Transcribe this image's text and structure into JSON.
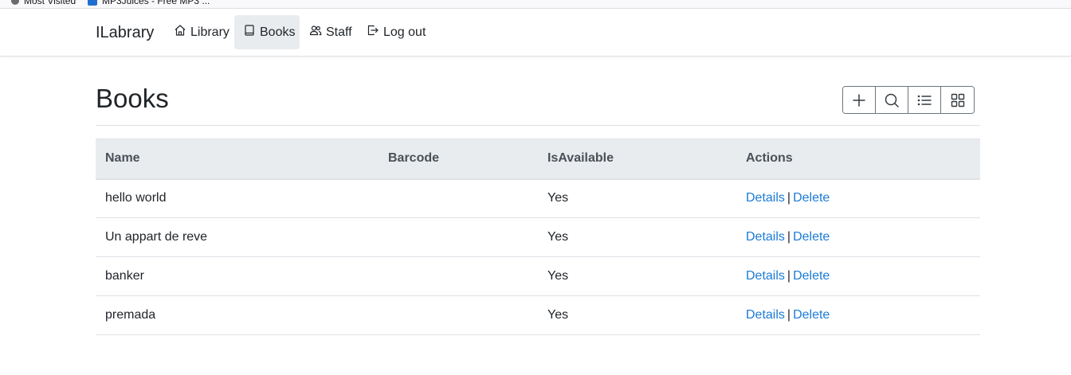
{
  "bookmarks": [
    {
      "label": "Most Visited"
    },
    {
      "label": "MP3Juices - Free MP3 ..."
    }
  ],
  "navbar": {
    "brand": "ILabrary",
    "items": [
      {
        "label": "Library",
        "icon": "home-icon"
      },
      {
        "label": "Books",
        "icon": "book-icon",
        "active": true
      },
      {
        "label": "Staff",
        "icon": "people-icon"
      },
      {
        "label": "Log out",
        "icon": "logout-icon"
      }
    ]
  },
  "page": {
    "title": "Books",
    "toolbar": [
      "plus-icon",
      "search-icon",
      "list-icon",
      "grid-icon"
    ]
  },
  "table": {
    "headers": [
      "Name",
      "Barcode",
      "IsAvailable",
      "Actions"
    ],
    "rows": [
      {
        "name": "hello world",
        "barcode": "",
        "available": "Yes"
      },
      {
        "name": "Un appart de reve",
        "barcode": "",
        "available": "Yes"
      },
      {
        "name": "banker",
        "barcode": "",
        "available": "Yes"
      },
      {
        "name": "premada",
        "barcode": "",
        "available": "Yes"
      }
    ],
    "actions": {
      "details": "Details",
      "separator": "|",
      "delete": "Delete"
    }
  },
  "colors": {
    "accent": "#1b7bd6",
    "active_nav": "#e9ecef",
    "header_bg": "#e9ecef"
  }
}
